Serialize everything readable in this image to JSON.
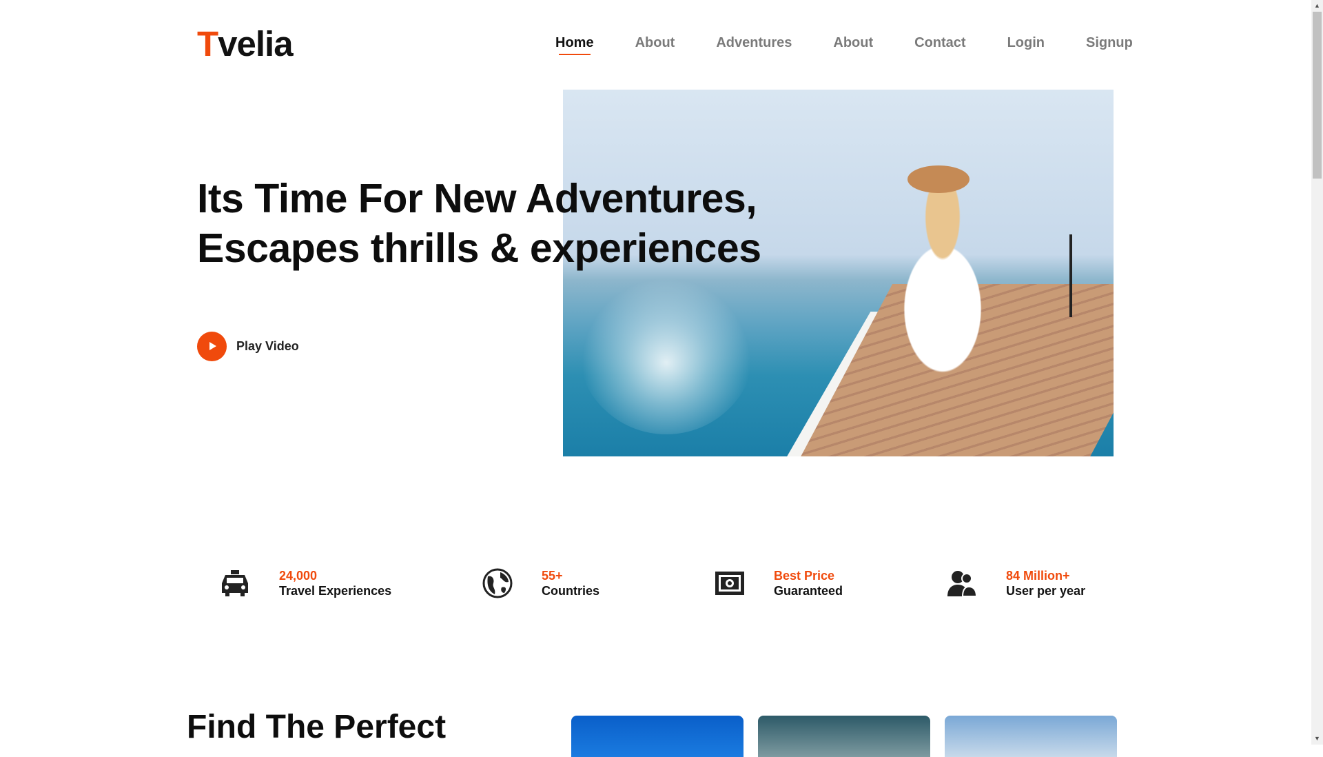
{
  "header": {
    "logo_first": "T",
    "logo_rest": "velia",
    "nav": [
      "Home",
      "About",
      "Adventures",
      "About",
      "Contact",
      "Login",
      "Signup"
    ]
  },
  "hero": {
    "headline": "Its Time For New Adventures, Escapes thrills & experiences",
    "play_label": "Play Video"
  },
  "stats": [
    {
      "top": "24,000",
      "bottom": "Travel Experiences",
      "icon": "taxi-icon"
    },
    {
      "top": "55+",
      "bottom": "Countries",
      "icon": "globe-icon"
    },
    {
      "top": "Best Price",
      "bottom": "Guaranteed",
      "icon": "money-icon"
    },
    {
      "top": "84 Million+",
      "bottom": "User per year",
      "icon": "users-icon"
    }
  ],
  "section": {
    "title": "Find The Perfect"
  },
  "colors": {
    "accent": "#f04a0c",
    "text": "#111111",
    "nav_inactive": "#7a7a7a"
  }
}
